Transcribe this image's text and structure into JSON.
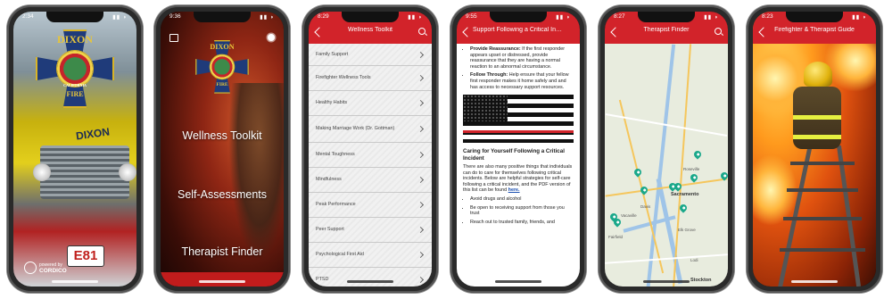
{
  "screens": [
    {
      "id": "splash",
      "status_time": "2:34",
      "badge_top": "DIXON",
      "badge_bottom": "FIRE",
      "badge_seal_text": "CALIFORNIA",
      "truck_text": "DIXON",
      "truck_plate": "E81",
      "powered_label": "powered by",
      "powered_brand": "CORDICO"
    },
    {
      "id": "home",
      "status_time": "9:36",
      "badge_top": "DIXON",
      "badge_bottom": "FIRE",
      "menu": [
        "Wellness Toolkit",
        "Self-Assessments",
        "Therapist Finder"
      ]
    },
    {
      "id": "wellness-toolkit",
      "status_time": "8:29",
      "title": "Wellness Toolkit",
      "items": [
        "Family Support",
        "Firefighter Wellness Tools",
        "Healthy Habits",
        "Making Marriage Work (Dr. Gottman)",
        "Mental Toughness",
        "Mindfulness",
        "Peak Performance",
        "Peer Support",
        "Psychological First Aid",
        "PTSD"
      ]
    },
    {
      "id": "article",
      "status_time": "9:55",
      "title": "Support Following a Critical Incident",
      "bullets": [
        {
          "bold": "Provide Reassurance:",
          "text": "If the first responder appears upset or distressed, provide reassurance that they are having a normal reaction to an abnormal circumstance."
        },
        {
          "bold": "Follow Through:",
          "text": "Help ensure that your fellow first responder makes it home safely and and has access to necessary support resources."
        }
      ],
      "heading": "Caring for Yourself Following a Critical Incident",
      "paragraph": "There are also many positive things that individuals can do to care for themselves following critical incidents. Below are helpful strategies for self-care following a critical incident, and the PDF version of this list can be found",
      "link": "here.",
      "tips": [
        "Avoid drugs and alcohol",
        "Be open to receiving support from those you trust",
        "Reach out to trusted family, friends, and"
      ]
    },
    {
      "id": "therapist-finder",
      "status_time": "8:27",
      "title": "Therapist Finder",
      "labels": [
        "Sacramento",
        "Roseville",
        "Fairfield",
        "Stockton",
        "Davis",
        "Elk Grove",
        "Lodi",
        "Vacaville"
      ]
    },
    {
      "id": "ladder",
      "status_time": "8:23",
      "title": "Firefighter & Therapist Guide"
    }
  ],
  "colors": {
    "nav_red": "#d2232a",
    "pin_teal": "#1aa88a",
    "badge_gold": "#e7c53a",
    "badge_navy": "#1f3b7a"
  }
}
